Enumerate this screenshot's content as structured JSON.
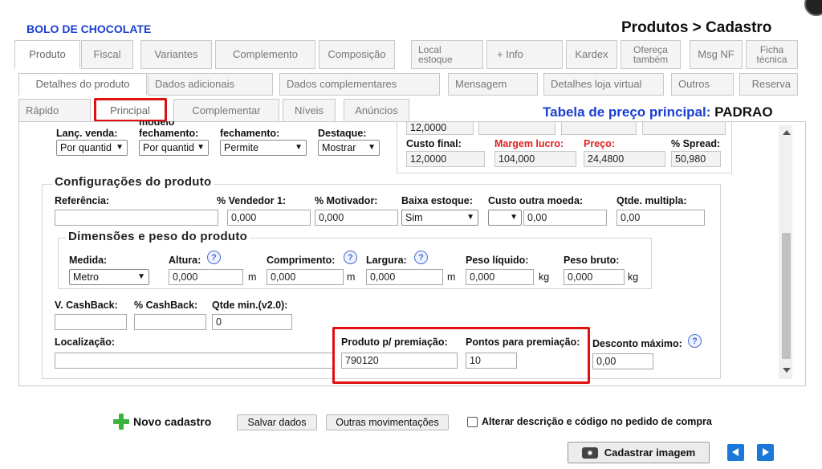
{
  "header": {
    "product_name": "BOLO DE CHOCOLATE",
    "breadcrumb": "Produtos > Cadastro"
  },
  "tabs_row1": [
    "Produto",
    "Fiscal",
    "Variantes",
    "Complemento",
    "Composição",
    "Local estoque",
    "+ Info",
    "Kardex",
    "Ofereça também",
    "Msg NF",
    "Ficha técnica"
  ],
  "tabs_row2": [
    "Detalhes do produto",
    "Dados adicionais",
    "Dados complementares",
    "Mensagem",
    "Detalhes loja virtual",
    "Outros",
    "Reserva"
  ],
  "tabs_row3": [
    "Rápido",
    "Principal",
    "Complementar",
    "Níveis",
    "Anúncios"
  ],
  "price_table": {
    "label": "Tabela de preço principal:",
    "value": "PADRAO"
  },
  "top_partial": {
    "lanc_venda_label": "Lanç. venda:",
    "lanc_venda_value": "Por quantid",
    "fechamento1_label": "fechamento:",
    "fechamento1_value": "Por quantid",
    "fechamento2_label": "fechamento:",
    "fechamento2_value": "Permite",
    "destaque_label": "Destaque:",
    "destaque_value": "Mostrar",
    "cost_value_top": "12,0000",
    "custo_final_label": "Custo final:",
    "custo_final_value": "12,0000",
    "margem_label": "Margem lucro:",
    "margem_value": "104,000",
    "preco_label": "Preço:",
    "preco_value": "24,4800",
    "spread_label": "% Spread:",
    "spread_value": "50,980"
  },
  "config": {
    "title": "Configurações do produto",
    "referencia_label": "Referência:",
    "referencia_value": "",
    "vendedor_label": "% Vendedor 1:",
    "vendedor_value": "0,000",
    "motivador_label": "% Motivador:",
    "motivador_value": "0,000",
    "baixa_label": "Baixa estoque:",
    "baixa_value": "Sim",
    "custo_moeda_label": "Custo outra moeda:",
    "custo_moeda_value": "0,00",
    "qtde_mult_label": "Qtde. multipla:",
    "qtde_mult_value": "0,00"
  },
  "dimensions": {
    "title": "Dimensões e peso do produto",
    "medida_label": "Medida:",
    "medida_value": "Metro",
    "altura_label": "Altura:",
    "altura_value": "0,000",
    "comprimento_label": "Comprimento:",
    "comprimento_value": "0,000",
    "largura_label": "Largura:",
    "largura_value": "0,000",
    "peso_liquido_label": "Peso líquido:",
    "peso_liquido_value": "0,000",
    "peso_bruto_label": "Peso bruto:",
    "peso_bruto_value": "0,000",
    "unit_m": "m",
    "unit_kg": "kg"
  },
  "cashback": {
    "v_label": "V. CashBack:",
    "v_value": "",
    "pct_label": "% CashBack:",
    "pct_value": "",
    "qtde_label": "Qtde min.(v2.0):",
    "qtde_value": "0"
  },
  "premiacao": {
    "localizacao_label": "Localização:",
    "localizacao_value": "",
    "produto_label": "Produto p/ premiação:",
    "produto_value": "790120",
    "pontos_label": "Pontos para premiação:",
    "pontos_value": "10",
    "desconto_label": "Desconto máximo:",
    "desconto_value": "0,00"
  },
  "footer": {
    "novo_cadastro": "Novo cadastro",
    "salvar": "Salvar dados",
    "outras": "Outras movimentações",
    "alterar_check": "Alterar descrição e código no pedido de compra",
    "cadastrar_imagem": "Cadastrar imagem"
  },
  "colors": {
    "accent_blue": "#1a3fd1",
    "highlight_red": "#e01010",
    "label_red": "#e02020"
  },
  "help_glyph": "?",
  "chevron_glyph": "⌄"
}
